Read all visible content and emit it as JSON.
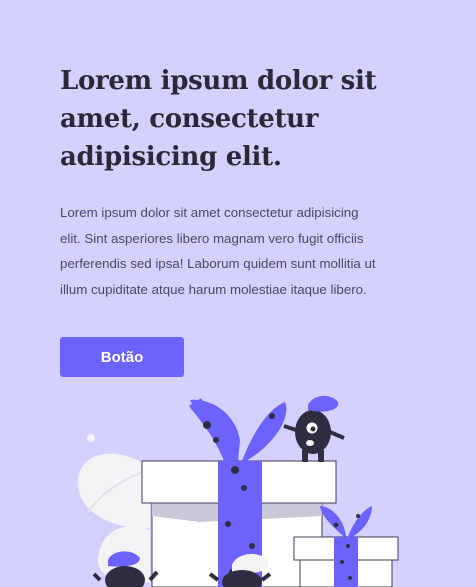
{
  "hero": {
    "headline": "Lorem ipsum dolor sit amet, consectetur adipisicing elit.",
    "paragraph": "Lorem ipsum dolor sit amet consectetur adipisicing elit. Sint asperiores libero magnam vero fugit officiis perferendis sed ipsa! Laborum quidem sunt mollitia ut illum cupiditate atque harum molestiae itaque libero.",
    "button_label": "Botão"
  },
  "colors": {
    "background": "#d4d0ff",
    "accent": "#6c63ff",
    "heading": "#2b2838",
    "text": "#4a4761"
  },
  "illustration": {
    "icon": "gift-boxes-monsters-illustration"
  }
}
